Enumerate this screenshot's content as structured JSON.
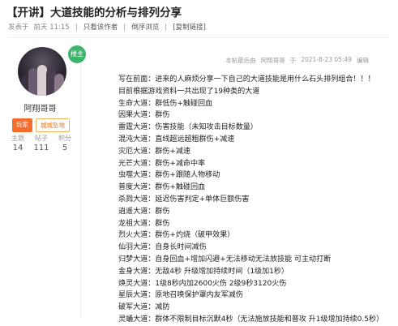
{
  "thread": {
    "title": "【开讲】大道技能的分析与排列分享",
    "posted_label": "发表于",
    "posted_time": "前天 11:15",
    "actions": [
      "只看该作者",
      "倒序浏览",
      "[复制链接]"
    ]
  },
  "author": {
    "name": "阿翔哥哥",
    "badge": "楼主",
    "tags": [
      "玩家",
      "城城坠地"
    ],
    "stats": [
      {
        "label": "主题",
        "value": "14"
      },
      {
        "label": "帖子",
        "value": "111"
      },
      {
        "label": "积分",
        "value": "5"
      }
    ]
  },
  "post": {
    "meta": [
      "本帖最后由",
      "阿翔哥哥",
      "于",
      "2021-8-23 05:49",
      "编辑"
    ],
    "lines": [
      "写在前面：进来的人麻烦分享一下自己的大道技能是用什么石头排列组合！！！",
      "目前根据游戏资料一共出现了19种类的大道",
      "生命大道：群低伤+触碰回血",
      "因果大道：群伤",
      "雷霆大道：伤害技能（未知攻击目标数量）",
      "混沌大道：直线超远超粗群伤+减速",
      "灾厄大道：群伤+减速",
      "光芒大道：群伤+减命中率",
      "虫噬大道：群伤+跟随人物移动",
      "普度大道：群伤+触碰回血",
      "杀戮大道：延迟伤害判定+单体巨额伤害",
      "逍遥大道：群伤",
      "龙祖大道：群伤",
      "烈火大道：群伤+灼烧（破甲效果）",
      "仙羽大道：自身长时间减伤",
      "归梦大道：自身回血+增加闪避+无法移动无法放技能 可主动打断",
      "金身大道：无敌4秒 升级增加持续时间（1级加1秒）",
      "焕灵大道：1级8秒内加2600火伤 2级9秒3120火伤",
      "星辰大道：原地召唤保护罩内友军减伤",
      "破军大道：减防",
      "灵蛹大道：群体不限制目标沉默4秒（无法施放技能和普攻 升1级增加持续0.5秒）"
    ]
  },
  "colors": {
    "host_badge": "#3cb56b",
    "player_tag": "#f56c2d",
    "location_tag": "#e27a16"
  }
}
